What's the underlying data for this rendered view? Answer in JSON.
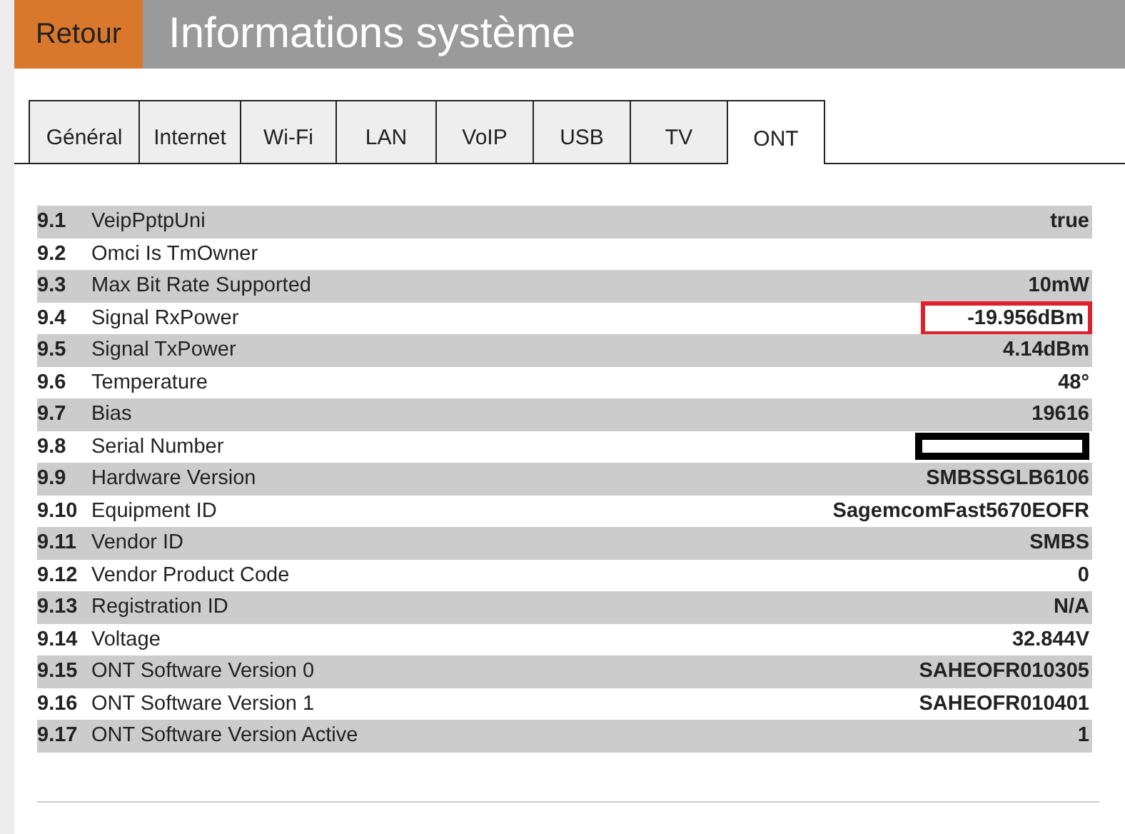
{
  "header": {
    "back_button": "Retour",
    "title": "Informations système"
  },
  "tabs": [
    {
      "label": "Général",
      "selected": false
    },
    {
      "label": "Internet",
      "selected": false
    },
    {
      "label": "Wi-Fi",
      "selected": false
    },
    {
      "label": "LAN",
      "selected": false
    },
    {
      "label": "VoIP",
      "selected": false
    },
    {
      "label": "USB",
      "selected": false
    },
    {
      "label": "TV",
      "selected": false
    },
    {
      "label": "ONT",
      "selected": true
    }
  ],
  "rows": [
    {
      "index": "9.1",
      "label": "VeipPptpUni",
      "kind": "text",
      "value": "true",
      "highlighted": false
    },
    {
      "index": "9.2",
      "label": "Omci Is TmOwner",
      "kind": "empty",
      "highlighted": false
    },
    {
      "index": "9.3",
      "label": "Max Bit Rate Supported",
      "kind": "text",
      "value": "10mW",
      "highlighted": false
    },
    {
      "index": "9.4",
      "label": "Signal RxPower",
      "kind": "text",
      "value": "-19.956dBm",
      "highlighted": true
    },
    {
      "index": "9.5",
      "label": "Signal TxPower",
      "kind": "text",
      "value": "4.14dBm",
      "highlighted": false
    },
    {
      "index": "9.6",
      "label": "Temperature",
      "kind": "text",
      "value": "48°",
      "highlighted": false
    },
    {
      "index": "9.7",
      "label": "Bias",
      "kind": "text",
      "value": "19616",
      "highlighted": false
    },
    {
      "index": "9.8",
      "label": "Serial Number",
      "kind": "redacted",
      "highlighted": false
    },
    {
      "index": "9.9",
      "label": "Hardware Version",
      "kind": "text",
      "value": "SMBSSGLB6106",
      "highlighted": false
    },
    {
      "index": "9.10",
      "label": "Equipment ID",
      "kind": "text",
      "value": "SagemcomFast5670EOFR",
      "highlighted": false
    },
    {
      "index": "9.11",
      "label": "Vendor ID",
      "kind": "text",
      "value": "SMBS",
      "highlighted": false
    },
    {
      "index": "9.12",
      "label": "Vendor Product Code",
      "kind": "text",
      "value": "0",
      "highlighted": false
    },
    {
      "index": "9.13",
      "label": "Registration ID",
      "kind": "text",
      "value": "N/A",
      "highlighted": false
    },
    {
      "index": "9.14",
      "label": "Voltage",
      "kind": "text",
      "value": "32.844V",
      "highlighted": false
    },
    {
      "index": "9.15",
      "label": "ONT Software Version 0",
      "kind": "text",
      "value": "SAHEOFR010305",
      "highlighted": false
    },
    {
      "index": "9.16",
      "label": "ONT Software Version 1",
      "kind": "text",
      "value": "SAHEOFR010401",
      "highlighted": false
    },
    {
      "index": "9.17",
      "label": "ONT Software Version Active",
      "kind": "text",
      "value": "1",
      "highlighted": false
    }
  ]
}
